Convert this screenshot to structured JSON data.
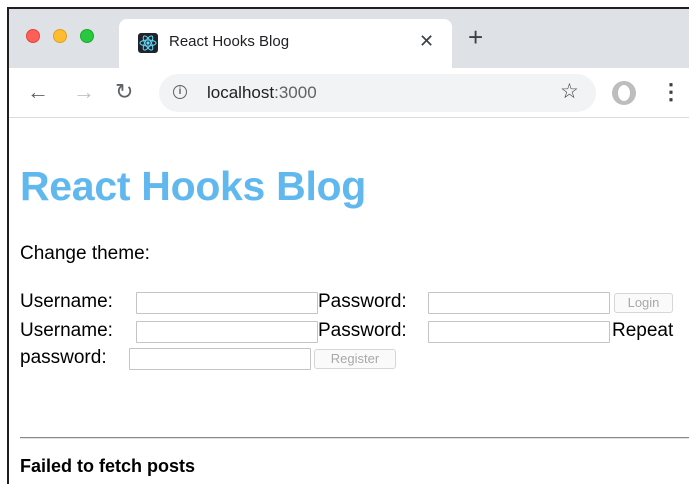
{
  "browser": {
    "tab": {
      "title": "React Hooks Blog"
    },
    "url": {
      "host": "localhost",
      "port": ":3000"
    }
  },
  "page": {
    "title": "React Hooks Blog",
    "theme_label": "Change theme:",
    "login": {
      "username_label": "Username:",
      "password_label": "Password:",
      "button": "Login"
    },
    "register": {
      "username_label": "Username:",
      "password_label": "Password:",
      "repeat_label_1": "Repeat",
      "repeat_label_2": "password:",
      "button": "Register"
    },
    "error": "Failed to fetch posts"
  },
  "colors": {
    "title": "#61b8ee",
    "tabstrip": "#dee1e6"
  },
  "icons": [
    "react-favicon-icon",
    "close-icon",
    "plus-icon",
    "back-arrow-icon",
    "forward-arrow-icon",
    "reload-icon",
    "info-icon",
    "star-icon",
    "profile-avatar-icon",
    "kebab-menu-icon"
  ]
}
